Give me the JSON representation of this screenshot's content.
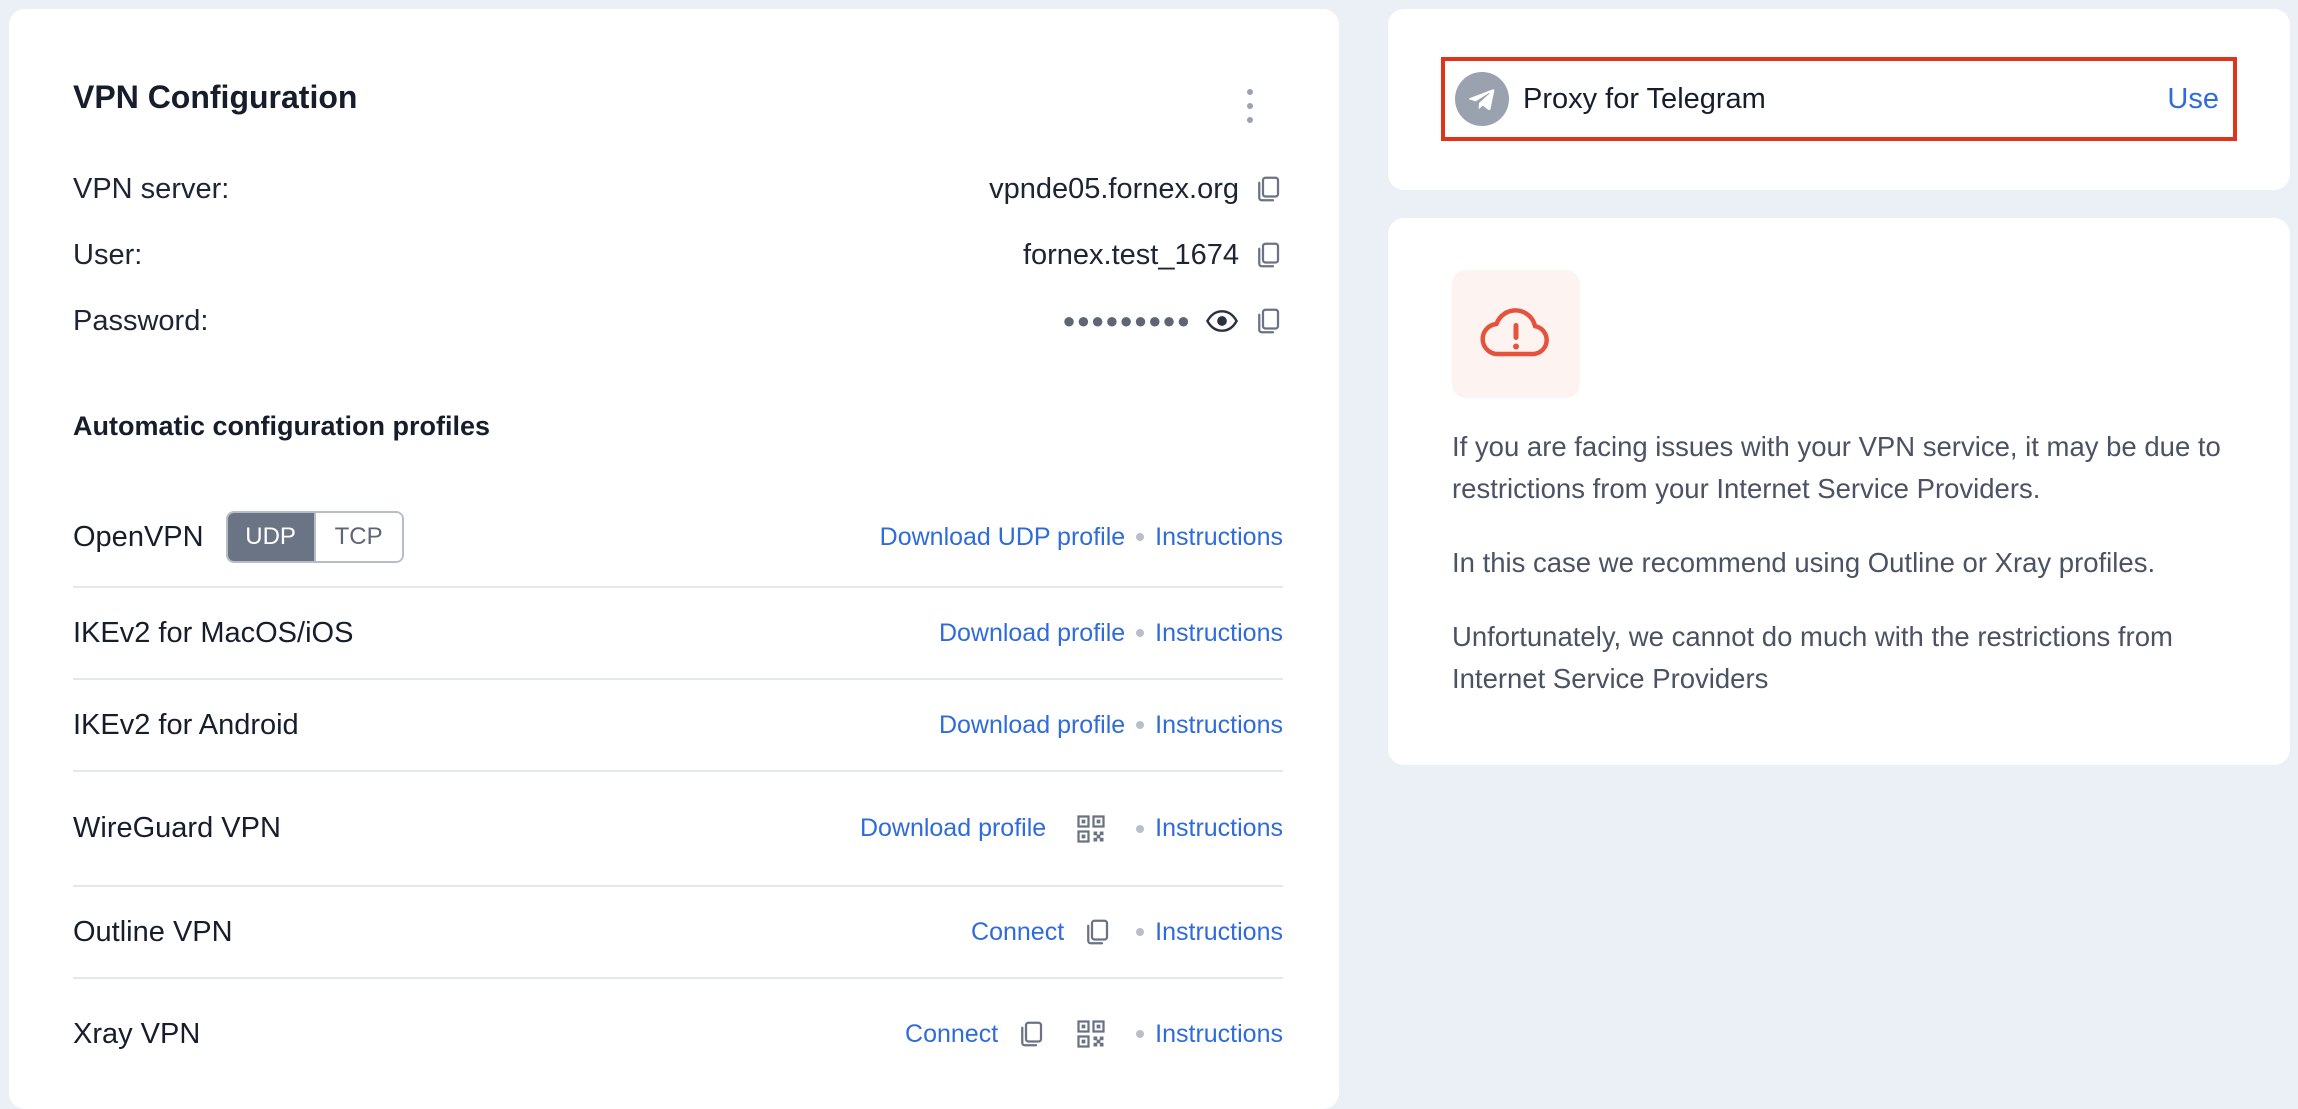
{
  "vpn": {
    "title": "VPN Configuration",
    "server_label": "VPN server:",
    "server_value": "vpnde05.fornex.org",
    "user_label": "User:",
    "user_value": "fornex.test_1674",
    "password_label": "Password:",
    "password_mask": "●●●●●●●●●",
    "profiles_title": "Automatic configuration profiles",
    "profiles": [
      {
        "name": "OpenVPN",
        "toggle": [
          "UDP",
          "TCP"
        ],
        "selected": "UDP",
        "download": "Download UDP profile",
        "instructions": "Instructions"
      },
      {
        "name": "IKEv2 for MacOS/iOS",
        "download": "Download profile",
        "instructions": "Instructions"
      },
      {
        "name": "IKEv2 for Android",
        "download": "Download profile",
        "instructions": "Instructions"
      },
      {
        "name": "WireGuard VPN",
        "download": "Download profile",
        "icon": "qr-code-icon",
        "instructions": "Instructions"
      },
      {
        "name": "Outline VPN",
        "connect": "Connect",
        "icon": "copy-icon",
        "instructions": "Instructions"
      },
      {
        "name": "Xray VPN",
        "connect": "Connect",
        "icons": [
          "copy-icon",
          "qr-code-icon"
        ],
        "instructions": "Instructions"
      }
    ]
  },
  "proxy": {
    "label": "Proxy for Telegram",
    "action": "Use",
    "icon": "telegram-icon"
  },
  "notice": {
    "icon": "cloud-alert-icon",
    "paragraphs": [
      "If you are facing issues with your VPN service, it may be due to restrictions from your Internet Service Providers.",
      "In this case we recommend using Outline or Xray profiles.",
      "Unfortunately, we cannot do much with the restrictions from Internet Service Providers"
    ]
  },
  "colors": {
    "background": "#ebf0f7",
    "link": "#2f6bdb",
    "highlight_border": "#e0331b",
    "alert_icon": "#e5533d",
    "toggle_active": "#6b7485"
  }
}
